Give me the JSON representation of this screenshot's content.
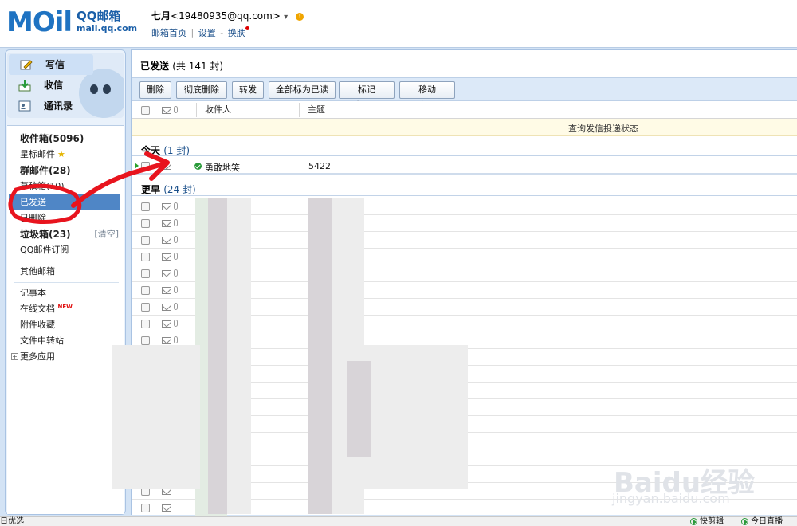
{
  "header": {
    "logo_text": "MOil",
    "logo_brand": "QQ邮箱",
    "logo_url": "mail.qq.com",
    "account_name": "七月",
    "account_email": "<19480935@qq.com>",
    "account_caret": "▾",
    "links": [
      "邮箱首页",
      "设置",
      "换肤"
    ],
    "link_sep": "|",
    "link_sep2": "-"
  },
  "sidebar": {
    "actions": [
      {
        "label": "写信",
        "icon": "pencil-icon"
      },
      {
        "label": "收信",
        "icon": "inbox-download-icon"
      },
      {
        "label": "通讯录",
        "icon": "contacts-icon"
      }
    ],
    "folders": [
      {
        "label": "收件箱(5096)",
        "bold": true
      },
      {
        "label": "星标邮件",
        "star": "★"
      },
      {
        "label": "群邮件(28)",
        "bold": true
      },
      {
        "label": "草稿箱(10)"
      },
      {
        "label": "已发送",
        "selected": true
      },
      {
        "label": "已删除"
      },
      {
        "label": "垃圾箱(23)",
        "bold": true,
        "action": "[清空]"
      },
      {
        "label": "QQ邮件订阅"
      }
    ],
    "other": "其他邮箱",
    "apps": [
      {
        "label": "记事本"
      },
      {
        "label": "在线文档",
        "badge": "NEW"
      },
      {
        "label": "附件收藏"
      },
      {
        "label": "文件中转站"
      }
    ],
    "more": "更多应用",
    "more_icon_glyph": "+"
  },
  "main": {
    "title": "已发送",
    "count_text": "(共 141 封)",
    "toolbar": [
      {
        "label": "删除"
      },
      {
        "label": "彻底删除"
      },
      {
        "label": "转发"
      },
      {
        "label": "全部标为已读"
      },
      {
        "label": "标记为...",
        "dropdown": true
      },
      {
        "label": "移动到...",
        "dropdown": true
      }
    ],
    "caret_glyph": "▼",
    "columns": {
      "recipient": "收件人",
      "subject": "主题"
    },
    "notice": "查询发信投递状态",
    "groups": [
      {
        "label": "今天",
        "count": "(1 封)"
      },
      {
        "label": "更早",
        "count": "(24 封)"
      }
    ],
    "today_row": {
      "recipient": "勇敢地笑",
      "subject": "5422"
    }
  },
  "statusbar": {
    "left": "日优选",
    "right1": "快剪辑",
    "right2": "今日直播"
  },
  "watermark": {
    "main": "Baidu经验",
    "sub": "jingyan.baidu.com"
  },
  "colors": {
    "accent": "#4f86c6",
    "toolbar_bg": "#dce9f8",
    "annotation_red": "#e8141e",
    "notice_bg": "#fffbe6"
  }
}
